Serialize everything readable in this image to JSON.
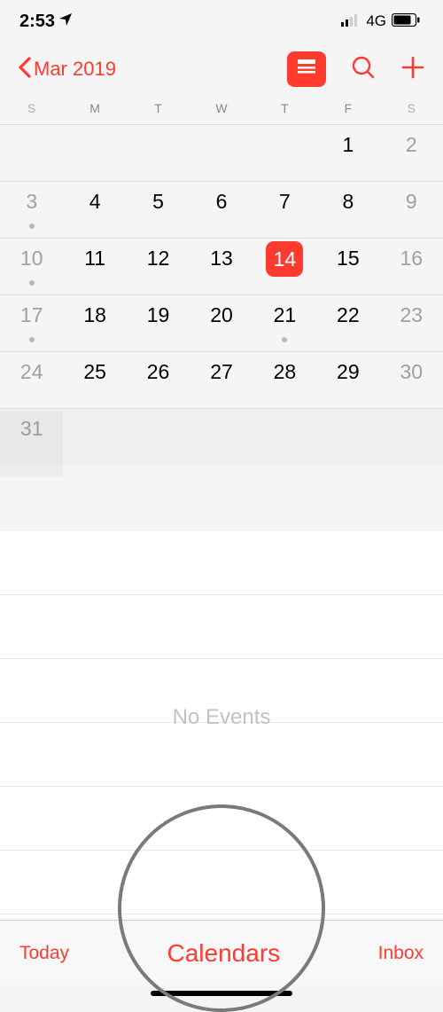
{
  "status": {
    "time": "2:53",
    "network": "4G"
  },
  "nav": {
    "back_label": "Mar 2019"
  },
  "day_headers": [
    "S",
    "M",
    "T",
    "W",
    "T",
    "F",
    "S"
  ],
  "weeks": [
    [
      {
        "n": "",
        "weekend": true
      },
      {
        "n": ""
      },
      {
        "n": ""
      },
      {
        "n": ""
      },
      {
        "n": ""
      },
      {
        "n": "1"
      },
      {
        "n": "2",
        "weekend": true
      }
    ],
    [
      {
        "n": "3",
        "weekend": true,
        "dot": true
      },
      {
        "n": "4"
      },
      {
        "n": "5"
      },
      {
        "n": "6"
      },
      {
        "n": "7"
      },
      {
        "n": "8"
      },
      {
        "n": "9",
        "weekend": true
      }
    ],
    [
      {
        "n": "10",
        "weekend": true,
        "dot": true
      },
      {
        "n": "11"
      },
      {
        "n": "12"
      },
      {
        "n": "13"
      },
      {
        "n": "14",
        "selected": true
      },
      {
        "n": "15"
      },
      {
        "n": "16",
        "weekend": true
      }
    ],
    [
      {
        "n": "17",
        "weekend": true,
        "dot": true
      },
      {
        "n": "18"
      },
      {
        "n": "19"
      },
      {
        "n": "20"
      },
      {
        "n": "21",
        "dot": true
      },
      {
        "n": "22"
      },
      {
        "n": "23",
        "weekend": true
      }
    ],
    [
      {
        "n": "24",
        "weekend": true
      },
      {
        "n": "25"
      },
      {
        "n": "26"
      },
      {
        "n": "27"
      },
      {
        "n": "28"
      },
      {
        "n": "29"
      },
      {
        "n": "30",
        "weekend": true
      }
    ],
    [
      {
        "n": "31",
        "weekend": true
      },
      {
        "n": ""
      },
      {
        "n": ""
      },
      {
        "n": ""
      },
      {
        "n": ""
      },
      {
        "n": ""
      },
      {
        "n": ""
      }
    ]
  ],
  "events": {
    "empty_label": "No Events"
  },
  "toolbar": {
    "today": "Today",
    "calendars": "Calendars",
    "inbox": "Inbox"
  }
}
